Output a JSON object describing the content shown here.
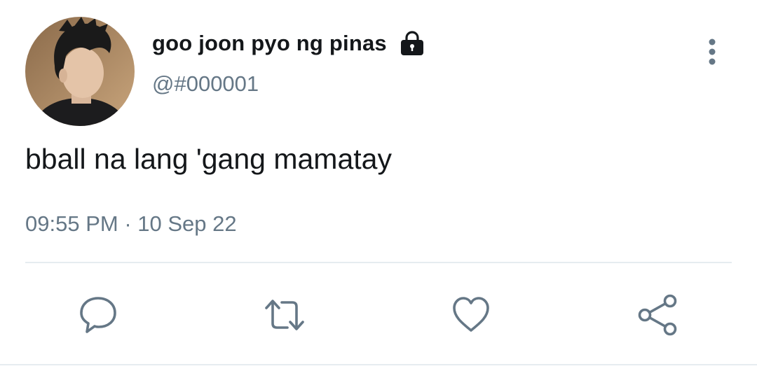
{
  "tweet": {
    "display_name": "goo joon pyo ng pinas",
    "handle": "@#000001",
    "text": "bball na lang 'gang mamatay",
    "time": "09:55 PM",
    "separator": "·",
    "date": "10 Sep 22"
  },
  "icons": {
    "lock": "lock-icon",
    "more": "vertical-ellipsis-icon",
    "reply": "reply-icon",
    "retweet": "retweet-icon",
    "like": "heart-icon",
    "share": "share-icon"
  },
  "colors": {
    "text_primary": "#14171a",
    "text_secondary": "#657786",
    "divider": "#e6ecf0"
  }
}
